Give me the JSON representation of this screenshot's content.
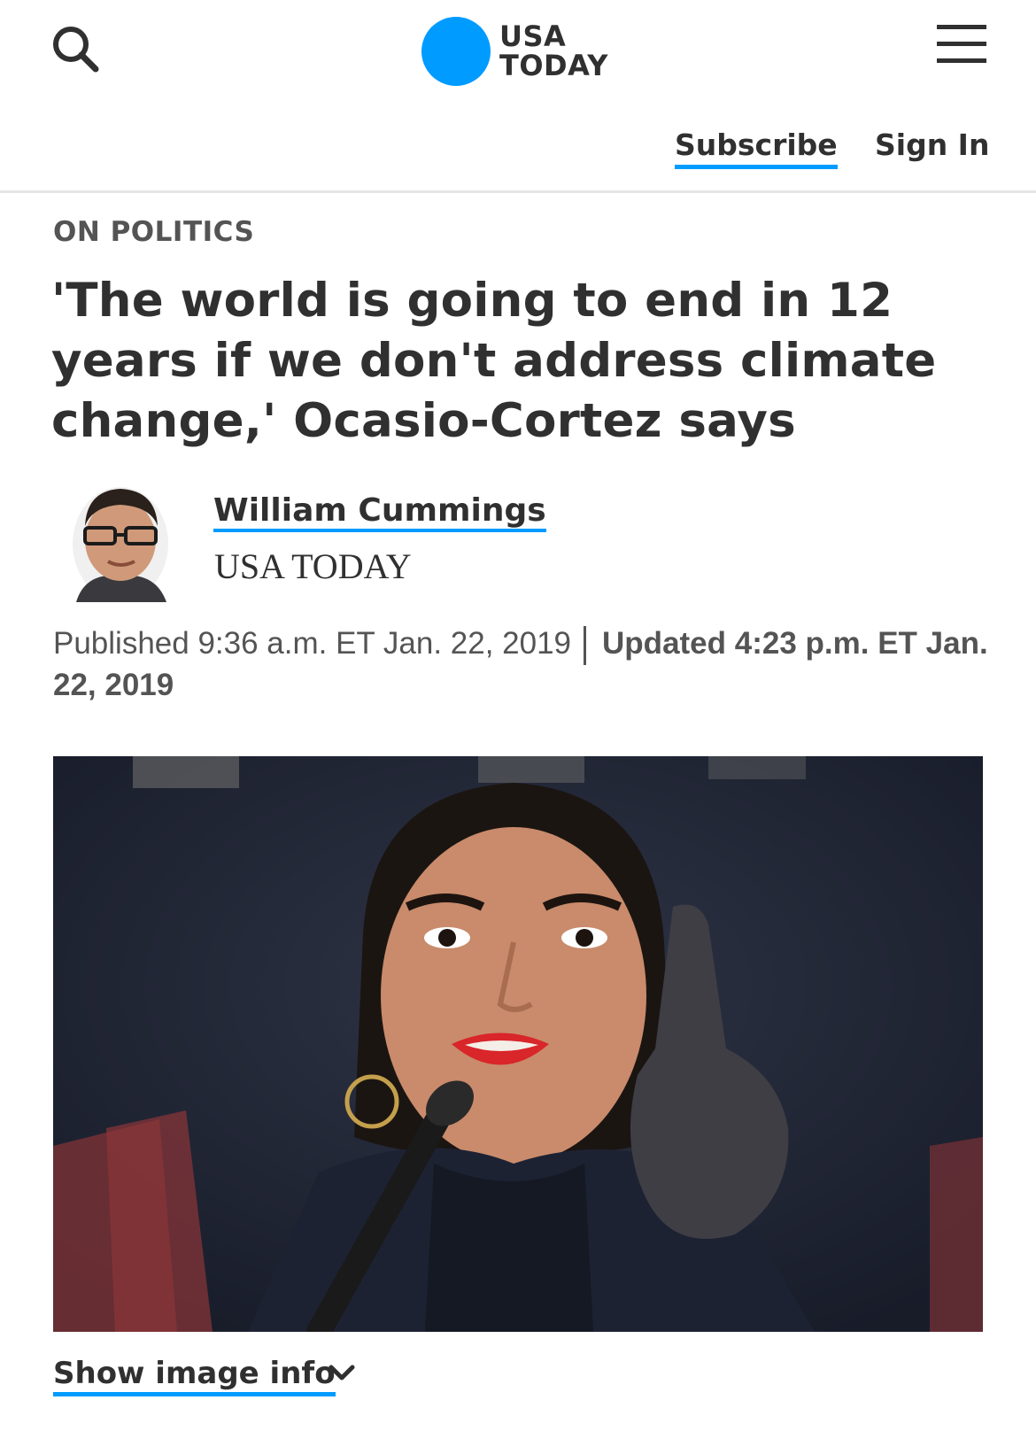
{
  "header": {
    "logo_line1": "USA",
    "logo_line2": "TODAY",
    "subscribe_label": "Subscribe",
    "signin_label": "Sign In",
    "accent_color": "#009bff"
  },
  "article": {
    "section": "ON POLITICS",
    "headline": "'The world is going to end in 12 years if we don't address climate change,' Ocasio-Cortez says",
    "author_name": "William Cummings",
    "author_org": "USA TODAY",
    "published": "Published 9:36 a.m. ET Jan. 22, 2019",
    "updated": "Updated 4:23 p.m. ET Jan. 22, 2019",
    "show_image_info": "Show image info"
  },
  "icons": {
    "search": "search-icon",
    "menu": "menu-icon",
    "chevron": "chevron-down-icon"
  }
}
